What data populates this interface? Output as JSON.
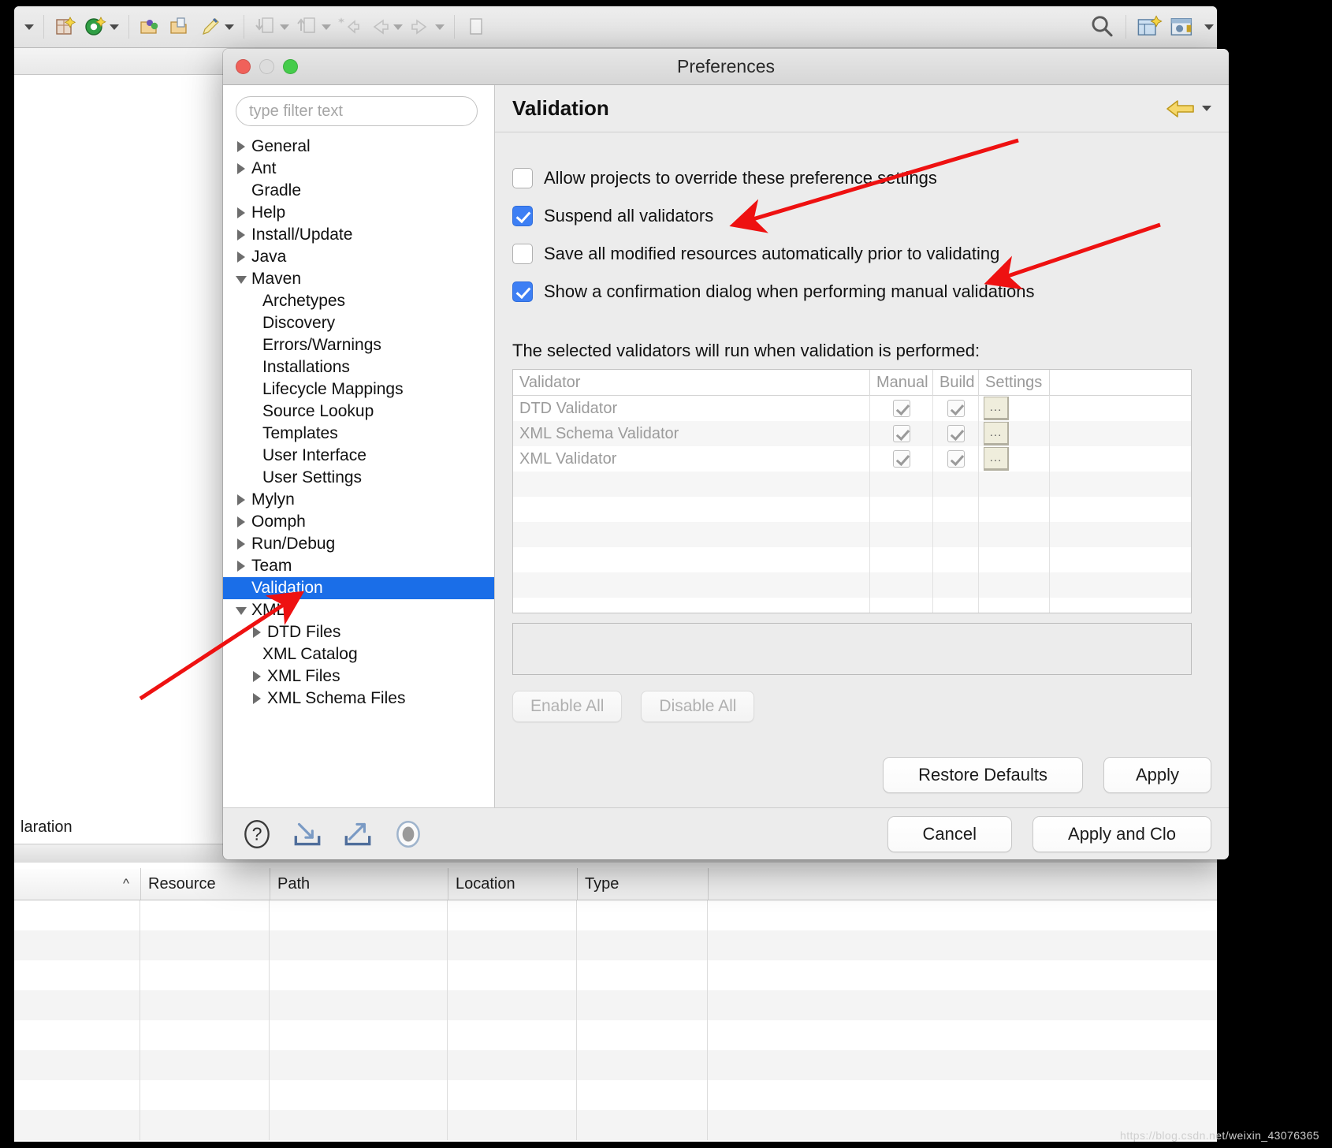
{
  "ide": {
    "toolbar": {
      "icons": [
        {
          "name": "dropdown-caret-icon",
          "glyph": "▾"
        },
        {
          "name": "new-wizard-icon",
          "glyph": "▦"
        },
        {
          "name": "new-grails-icon",
          "glyph": "◉"
        },
        {
          "name": "new-dropdown-caret-icon",
          "glyph": "▾"
        },
        {
          "name": "open-type-icon",
          "glyph": "📂"
        },
        {
          "name": "open-task-icon",
          "glyph": "🗂"
        },
        {
          "name": "edit-pen-icon",
          "glyph": "✎"
        },
        {
          "name": "edit-dropdown-caret-icon",
          "glyph": "▾"
        },
        {
          "name": "import-icon",
          "glyph": "⤓"
        },
        {
          "name": "import-caret-icon",
          "glyph": "▾"
        },
        {
          "name": "export-icon",
          "glyph": "⤒"
        },
        {
          "name": "export-caret-icon",
          "glyph": "▾"
        },
        {
          "name": "next-annotation-icon",
          "glyph": "✳"
        },
        {
          "name": "back-icon",
          "glyph": "⬅"
        },
        {
          "name": "back-caret-icon",
          "glyph": "▾"
        },
        {
          "name": "forward-icon",
          "glyph": "➡"
        },
        {
          "name": "forward-caret-icon",
          "glyph": "▾"
        },
        {
          "name": "new-window-icon",
          "glyph": "🗋"
        },
        {
          "name": "search-icon",
          "glyph": "search"
        },
        {
          "name": "perspective-open-icon",
          "glyph": "▤"
        },
        {
          "name": "perspective-java-icon",
          "glyph": "☕"
        }
      ]
    },
    "editor": {
      "declaration_label": "laration"
    },
    "problems": {
      "sort_indicator": "^",
      "columns": [
        "Resource",
        "Path",
        "Location",
        "Type"
      ],
      "rows": []
    }
  },
  "preferences": {
    "title": "Preferences",
    "window_controls": {
      "close": "close-button",
      "minimize": "minimize-button",
      "zoom": "zoom-button"
    },
    "filter": {
      "placeholder": "type filter text",
      "value": ""
    },
    "tree": [
      {
        "label": "General",
        "indent": 0,
        "twisty": "closed",
        "selected": false
      },
      {
        "label": "Ant",
        "indent": 0,
        "twisty": "closed",
        "selected": false
      },
      {
        "label": "Gradle",
        "indent": 0,
        "twisty": "none",
        "selected": false
      },
      {
        "label": "Help",
        "indent": 0,
        "twisty": "closed",
        "selected": false
      },
      {
        "label": "Install/Update",
        "indent": 0,
        "twisty": "closed",
        "selected": false
      },
      {
        "label": "Java",
        "indent": 0,
        "twisty": "closed",
        "selected": false
      },
      {
        "label": "Maven",
        "indent": 0,
        "twisty": "open",
        "selected": false
      },
      {
        "label": "Archetypes",
        "indent": 2,
        "twisty": "none",
        "selected": false
      },
      {
        "label": "Discovery",
        "indent": 2,
        "twisty": "none",
        "selected": false
      },
      {
        "label": "Errors/Warnings",
        "indent": 2,
        "twisty": "none",
        "selected": false
      },
      {
        "label": "Installations",
        "indent": 2,
        "twisty": "none",
        "selected": false
      },
      {
        "label": "Lifecycle Mappings",
        "indent": 2,
        "twisty": "none",
        "selected": false
      },
      {
        "label": "Source Lookup",
        "indent": 2,
        "twisty": "none",
        "selected": false
      },
      {
        "label": "Templates",
        "indent": 2,
        "twisty": "none",
        "selected": false
      },
      {
        "label": "User Interface",
        "indent": 2,
        "twisty": "none",
        "selected": false
      },
      {
        "label": "User Settings",
        "indent": 2,
        "twisty": "none",
        "selected": false
      },
      {
        "label": "Mylyn",
        "indent": 0,
        "twisty": "closed",
        "selected": false
      },
      {
        "label": "Oomph",
        "indent": 0,
        "twisty": "closed",
        "selected": false
      },
      {
        "label": "Run/Debug",
        "indent": 0,
        "twisty": "closed",
        "selected": false
      },
      {
        "label": "Team",
        "indent": 0,
        "twisty": "closed",
        "selected": false
      },
      {
        "label": "Validation",
        "indent": 1,
        "twisty": "none",
        "selected": true
      },
      {
        "label": "XML",
        "indent": 0,
        "twisty": "open",
        "selected": false
      },
      {
        "label": "DTD Files",
        "indent": 1,
        "twisty": "closed",
        "selected": false
      },
      {
        "label": "XML Catalog",
        "indent": 2,
        "twisty": "none",
        "selected": false
      },
      {
        "label": "XML Files",
        "indent": 1,
        "twisty": "closed",
        "selected": false
      },
      {
        "label": "XML Schema Files",
        "indent": 1,
        "twisty": "closed",
        "selected": false
      }
    ],
    "page": {
      "title": "Validation",
      "nav_back_icon": "back-arrow-icon",
      "nav_back_caret": "▾",
      "checkboxes": [
        {
          "label": "Allow projects to override these preference settings",
          "checked": false
        },
        {
          "label": "Suspend all validators",
          "checked": true
        },
        {
          "label": "Save all modified resources automatically prior to validating",
          "checked": false
        },
        {
          "label": "Show a confirmation dialog when performing manual validations",
          "checked": true
        }
      ],
      "table_caption": "The selected validators will run when validation is performed:",
      "table": {
        "columns": [
          "Validator",
          "Manual",
          "Build",
          "Settings"
        ],
        "rows": [
          {
            "name": "DTD Validator",
            "manual": true,
            "build": true,
            "settings": "..."
          },
          {
            "name": "XML Schema Validator",
            "manual": true,
            "build": true,
            "settings": "..."
          },
          {
            "name": "XML Validator",
            "manual": true,
            "build": true,
            "settings": "..."
          }
        ],
        "empty_rows": 6
      },
      "enable_all_label": "Enable All",
      "disable_all_label": "Disable All",
      "restore_defaults_label": "Restore Defaults",
      "apply_label": "Apply"
    },
    "footer": {
      "icons": [
        {
          "name": "help-icon",
          "glyph": "?"
        },
        {
          "name": "import-preferences-icon",
          "glyph": "import"
        },
        {
          "name": "export-preferences-icon",
          "glyph": "export"
        },
        {
          "name": "toggle-icon",
          "glyph": "toggle"
        }
      ],
      "cancel_label": "Cancel",
      "apply_and_close_label": "Apply and Clo"
    }
  },
  "annotations": {
    "arrow_color": "#ee1111",
    "arrows": [
      {
        "name": "arrow-to-suspend-all-validators"
      },
      {
        "name": "arrow-to-confirmation-dialog"
      },
      {
        "name": "arrow-to-xml-node"
      }
    ]
  },
  "watermark": "https://blog.csdn.net/weixin_43076365"
}
